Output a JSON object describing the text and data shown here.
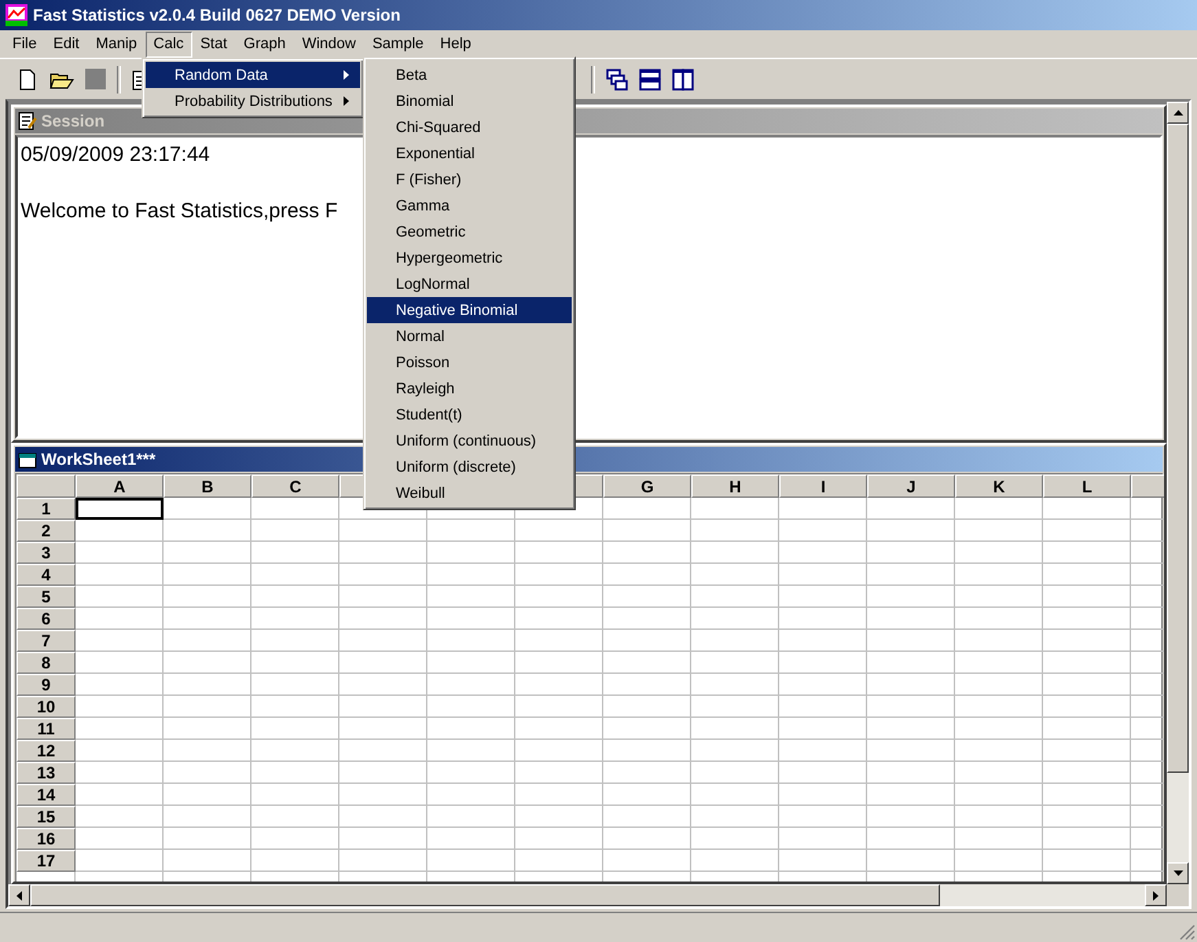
{
  "window": {
    "title": "Fast Statistics v2.0.4 Build 0627 DEMO Version"
  },
  "menubar": [
    {
      "label": "File",
      "selected": false
    },
    {
      "label": "Edit",
      "selected": false
    },
    {
      "label": "Manip",
      "selected": false
    },
    {
      "label": "Calc",
      "selected": true
    },
    {
      "label": "Stat",
      "selected": false
    },
    {
      "label": "Graph",
      "selected": false
    },
    {
      "label": "Window",
      "selected": false
    },
    {
      "label": "Sample",
      "selected": false
    },
    {
      "label": "Help",
      "selected": false
    }
  ],
  "calc_menu": [
    {
      "label": "Random Data",
      "selected": true,
      "submenu": true
    },
    {
      "label": "Probability Distributions",
      "selected": false,
      "submenu": true
    }
  ],
  "random_data_menu": [
    {
      "label": "Beta",
      "selected": false
    },
    {
      "label": "Binomial",
      "selected": false
    },
    {
      "label": "Chi-Squared",
      "selected": false
    },
    {
      "label": "Exponential",
      "selected": false
    },
    {
      "label": "F (Fisher)",
      "selected": false
    },
    {
      "label": "Gamma",
      "selected": false
    },
    {
      "label": "Geometric",
      "selected": false
    },
    {
      "label": "Hypergeometric",
      "selected": false
    },
    {
      "label": "LogNormal",
      "selected": false
    },
    {
      "label": "Negative Binomial",
      "selected": true
    },
    {
      "label": "Normal",
      "selected": false
    },
    {
      "label": "Poisson",
      "selected": false
    },
    {
      "label": "Rayleigh",
      "selected": false
    },
    {
      "label": "Student(t)",
      "selected": false
    },
    {
      "label": "Uniform (continuous)",
      "selected": false
    },
    {
      "label": "Uniform (discrete)",
      "selected": false
    },
    {
      "label": "Weibull",
      "selected": false
    }
  ],
  "session": {
    "title": "Session",
    "active": false,
    "lines": [
      "05/09/2009 23:17:44",
      "Welcome to Fast Statistics,press F"
    ]
  },
  "worksheet": {
    "title": "WorkSheet1***",
    "active": true,
    "columns": [
      "A",
      "B",
      "C",
      null,
      null,
      null,
      "G",
      "H",
      "I",
      "J",
      "K",
      "L"
    ],
    "rows": [
      {
        "label": "1",
        "cells": [
          {
            "active": true
          },
          {
            "active": false
          },
          {
            "active": false
          },
          {
            "active": false
          },
          {
            "active": false
          },
          {
            "active": false
          },
          {
            "active": false
          },
          {
            "active": false
          },
          {
            "active": false
          },
          {
            "active": false
          },
          {
            "active": false
          },
          {
            "active": false
          }
        ]
      },
      {
        "label": "2",
        "cells": [
          {
            "active": false
          },
          {
            "active": false
          },
          {
            "active": false
          },
          {
            "active": false
          },
          {
            "active": false
          },
          {
            "active": false
          },
          {
            "active": false
          },
          {
            "active": false
          },
          {
            "active": false
          },
          {
            "active": false
          },
          {
            "active": false
          },
          {
            "active": false
          }
        ]
      },
      {
        "label": "3",
        "cells": [
          {
            "active": false
          },
          {
            "active": false
          },
          {
            "active": false
          },
          {
            "active": false
          },
          {
            "active": false
          },
          {
            "active": false
          },
          {
            "active": false
          },
          {
            "active": false
          },
          {
            "active": false
          },
          {
            "active": false
          },
          {
            "active": false
          },
          {
            "active": false
          }
        ]
      },
      {
        "label": "4",
        "cells": [
          {
            "active": false
          },
          {
            "active": false
          },
          {
            "active": false
          },
          {
            "active": false
          },
          {
            "active": false
          },
          {
            "active": false
          },
          {
            "active": false
          },
          {
            "active": false
          },
          {
            "active": false
          },
          {
            "active": false
          },
          {
            "active": false
          },
          {
            "active": false
          }
        ]
      },
      {
        "label": "5",
        "cells": [
          {
            "active": false
          },
          {
            "active": false
          },
          {
            "active": false
          },
          {
            "active": false
          },
          {
            "active": false
          },
          {
            "active": false
          },
          {
            "active": false
          },
          {
            "active": false
          },
          {
            "active": false
          },
          {
            "active": false
          },
          {
            "active": false
          },
          {
            "active": false
          }
        ]
      },
      {
        "label": "6",
        "cells": [
          {
            "active": false
          },
          {
            "active": false
          },
          {
            "active": false
          },
          {
            "active": false
          },
          {
            "active": false
          },
          {
            "active": false
          },
          {
            "active": false
          },
          {
            "active": false
          },
          {
            "active": false
          },
          {
            "active": false
          },
          {
            "active": false
          },
          {
            "active": false
          }
        ]
      },
      {
        "label": "7",
        "cells": [
          {
            "active": false
          },
          {
            "active": false
          },
          {
            "active": false
          },
          {
            "active": false
          },
          {
            "active": false
          },
          {
            "active": false
          },
          {
            "active": false
          },
          {
            "active": false
          },
          {
            "active": false
          },
          {
            "active": false
          },
          {
            "active": false
          },
          {
            "active": false
          }
        ]
      },
      {
        "label": "8",
        "cells": [
          {
            "active": false
          },
          {
            "active": false
          },
          {
            "active": false
          },
          {
            "active": false
          },
          {
            "active": false
          },
          {
            "active": false
          },
          {
            "active": false
          },
          {
            "active": false
          },
          {
            "active": false
          },
          {
            "active": false
          },
          {
            "active": false
          },
          {
            "active": false
          }
        ]
      },
      {
        "label": "9",
        "cells": [
          {
            "active": false
          },
          {
            "active": false
          },
          {
            "active": false
          },
          {
            "active": false
          },
          {
            "active": false
          },
          {
            "active": false
          },
          {
            "active": false
          },
          {
            "active": false
          },
          {
            "active": false
          },
          {
            "active": false
          },
          {
            "active": false
          },
          {
            "active": false
          }
        ]
      },
      {
        "label": "10",
        "cells": [
          {
            "active": false
          },
          {
            "active": false
          },
          {
            "active": false
          },
          {
            "active": false
          },
          {
            "active": false
          },
          {
            "active": false
          },
          {
            "active": false
          },
          {
            "active": false
          },
          {
            "active": false
          },
          {
            "active": false
          },
          {
            "active": false
          },
          {
            "active": false
          }
        ]
      },
      {
        "label": "11",
        "cells": [
          {
            "active": false
          },
          {
            "active": false
          },
          {
            "active": false
          },
          {
            "active": false
          },
          {
            "active": false
          },
          {
            "active": false
          },
          {
            "active": false
          },
          {
            "active": false
          },
          {
            "active": false
          },
          {
            "active": false
          },
          {
            "active": false
          },
          {
            "active": false
          }
        ]
      },
      {
        "label": "12",
        "cells": [
          {
            "active": false
          },
          {
            "active": false
          },
          {
            "active": false
          },
          {
            "active": false
          },
          {
            "active": false
          },
          {
            "active": false
          },
          {
            "active": false
          },
          {
            "active": false
          },
          {
            "active": false
          },
          {
            "active": false
          },
          {
            "active": false
          },
          {
            "active": false
          }
        ]
      },
      {
        "label": "13",
        "cells": [
          {
            "active": false
          },
          {
            "active": false
          },
          {
            "active": false
          },
          {
            "active": false
          },
          {
            "active": false
          },
          {
            "active": false
          },
          {
            "active": false
          },
          {
            "active": false
          },
          {
            "active": false
          },
          {
            "active": false
          },
          {
            "active": false
          },
          {
            "active": false
          }
        ]
      },
      {
        "label": "14",
        "cells": [
          {
            "active": false
          },
          {
            "active": false
          },
          {
            "active": false
          },
          {
            "active": false
          },
          {
            "active": false
          },
          {
            "active": false
          },
          {
            "active": false
          },
          {
            "active": false
          },
          {
            "active": false
          },
          {
            "active": false
          },
          {
            "active": false
          },
          {
            "active": false
          }
        ]
      },
      {
        "label": "15",
        "cells": [
          {
            "active": false
          },
          {
            "active": false
          },
          {
            "active": false
          },
          {
            "active": false
          },
          {
            "active": false
          },
          {
            "active": false
          },
          {
            "active": false
          },
          {
            "active": false
          },
          {
            "active": false
          },
          {
            "active": false
          },
          {
            "active": false
          },
          {
            "active": false
          }
        ]
      },
      {
        "label": "16",
        "cells": [
          {
            "active": false
          },
          {
            "active": false
          },
          {
            "active": false
          },
          {
            "active": false
          },
          {
            "active": false
          },
          {
            "active": false
          },
          {
            "active": false
          },
          {
            "active": false
          },
          {
            "active": false
          },
          {
            "active": false
          },
          {
            "active": false
          },
          {
            "active": false
          }
        ]
      },
      {
        "label": "17",
        "cells": [
          {
            "active": false
          },
          {
            "active": false
          },
          {
            "active": false
          },
          {
            "active": false
          },
          {
            "active": false
          },
          {
            "active": false
          },
          {
            "active": false
          },
          {
            "active": false
          },
          {
            "active": false
          },
          {
            "active": false
          },
          {
            "active": false
          },
          {
            "active": false
          }
        ]
      }
    ]
  }
}
